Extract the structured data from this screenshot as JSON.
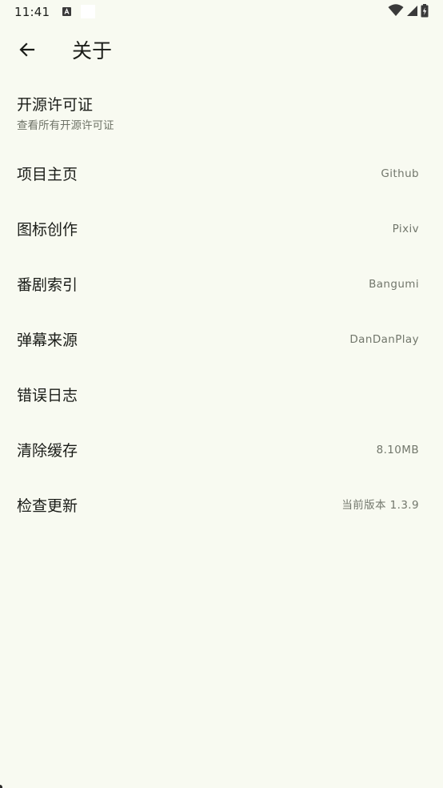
{
  "status_bar": {
    "time": "11:41",
    "icons": [
      "a-notification-icon",
      "wifi-icon",
      "signal-icon",
      "battery-charging-icon"
    ]
  },
  "toolbar": {
    "title": "关于",
    "back_icon": "arrow-left-icon"
  },
  "items": [
    {
      "title": "开源许可证",
      "subtitle": "查看所有开源许可证",
      "value": ""
    },
    {
      "title": "项目主页",
      "subtitle": "",
      "value": "Github"
    },
    {
      "title": "图标创作",
      "subtitle": "",
      "value": "Pixiv"
    },
    {
      "title": "番剧索引",
      "subtitle": "",
      "value": "Bangumi"
    },
    {
      "title": "弹幕来源",
      "subtitle": "",
      "value": "DanDanPlay"
    },
    {
      "title": "错误日志",
      "subtitle": "",
      "value": ""
    },
    {
      "title": "清除缓存",
      "subtitle": "",
      "value": "8.10MB"
    },
    {
      "title": "检查更新",
      "subtitle": "",
      "value": "当前版本 1.3.9"
    }
  ],
  "colors": {
    "background": "#f8faf1",
    "primary_text": "#1a1c18",
    "secondary_text": "#72776c"
  }
}
